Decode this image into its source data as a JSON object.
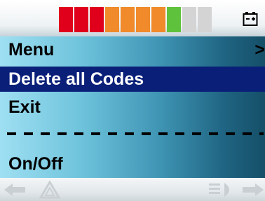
{
  "status_bar": {
    "battery_level_segments": [
      {
        "color": "#e0001c"
      },
      {
        "color": "#e0001c"
      },
      {
        "color": "#e0001c"
      },
      {
        "color": "#f08a2a"
      },
      {
        "color": "#f08a2a"
      },
      {
        "color": "#f08a2a"
      },
      {
        "color": "#f08a2a"
      },
      {
        "color": "#5fc23c"
      },
      {
        "color": "#d4d4d4"
      },
      {
        "color": "#d4d4d4"
      }
    ],
    "battery_icon": "battery-icon"
  },
  "menu": {
    "items": [
      {
        "label": "Menu",
        "trailing": ">"
      },
      {
        "label": "Delete all Codes",
        "selected": true
      },
      {
        "label": "Exit"
      },
      {
        "label": "On/Off"
      }
    ]
  },
  "bottom_bar": {
    "icons": [
      "left-arrow-icon",
      "warning-triangle-icon",
      "lights-icon",
      "right-arrow-icon"
    ]
  },
  "colors": {
    "selection": "#0a1f78",
    "text": "#000000",
    "selected_text": "#ffffff"
  }
}
